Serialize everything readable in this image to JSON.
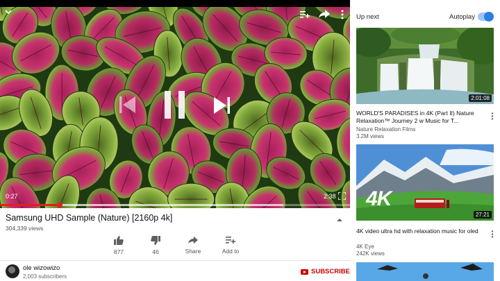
{
  "player": {
    "elapsed": "0:27",
    "duration": "2:38",
    "progress_fraction": 0.17,
    "buffered_fraction": 0.81
  },
  "video": {
    "title": "Samsung UHD Sample (Nature) [2160p 4k]",
    "views": "304,339 views"
  },
  "actions": {
    "like_count": "877",
    "dislike_count": "46",
    "share_label": "Share",
    "add_to_label": "Add to"
  },
  "channel": {
    "name": "ole wizowizo",
    "subscribers": "2,003 subscribers",
    "subscribe_label": "SUBSCRIBE"
  },
  "sidebar": {
    "up_next_label": "Up next",
    "autoplay_label": "Autoplay",
    "autoplay_on": true,
    "items": [
      {
        "title": "WORLD'S PARADISES in 4K (Part II) Nature Relaxation™ Journey 2 w Music for T...",
        "channel": "Nature Relaxation Films",
        "views": "3.2M views",
        "duration": "2:01:08"
      },
      {
        "title": "4K video ultra hd with relaxation music for oled",
        "channel": "4K Eye",
        "views": "242K views",
        "duration": "27:21",
        "thumb_text": "4K"
      }
    ]
  },
  "colors": {
    "accent_red": "#e02020",
    "subscribe_red": "#cc0000",
    "toggle_blue": "#2a7de1"
  },
  "icons": {
    "minimize": "chevron-down-icon",
    "queue": "playlist-add-icon",
    "share": "share-arrow-icon",
    "menu": "more-vert-icon",
    "previous": "skip-previous-icon",
    "pause": "pause-icon",
    "next": "skip-next-icon",
    "fullscreen": "fullscreen-icon"
  }
}
